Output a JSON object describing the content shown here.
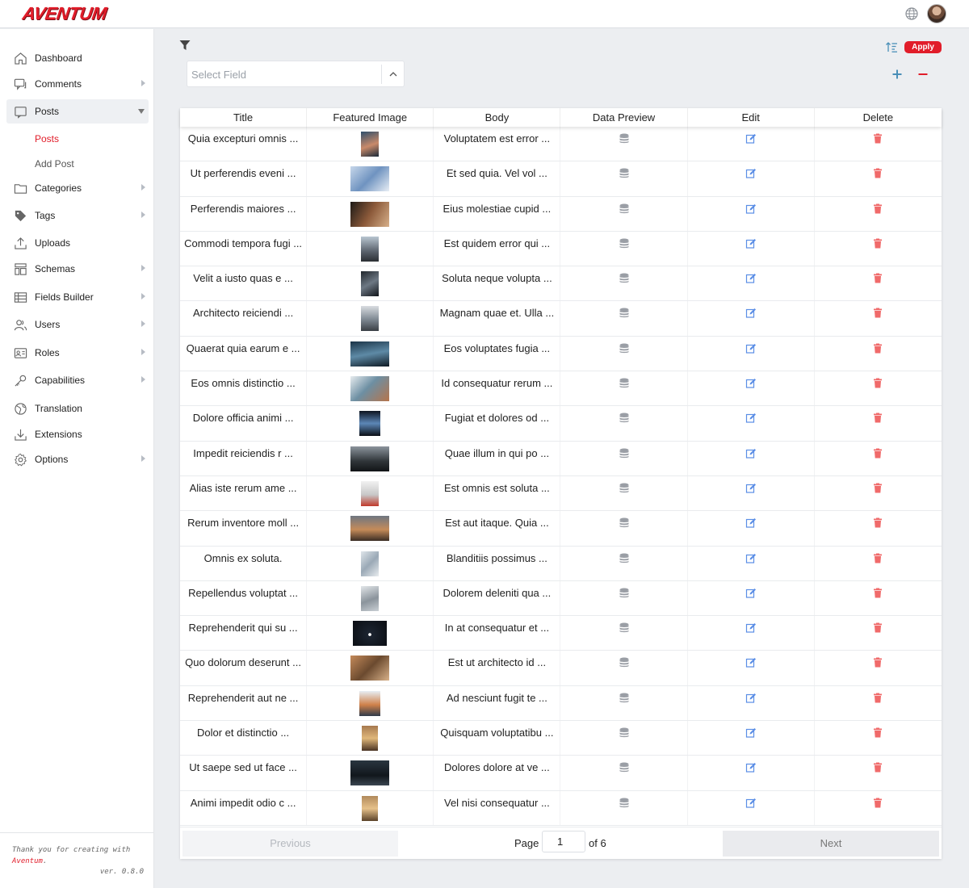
{
  "header": {
    "logo": "AVENTUM",
    "globe_icon": "globe-icon",
    "avatar_icon": "user-avatar"
  },
  "sidebar": {
    "items": [
      {
        "label": "Dashboard",
        "icon": "home-icon"
      },
      {
        "label": "Comments",
        "icon": "comments-icon"
      },
      {
        "label": "Posts",
        "icon": "posts-icon"
      },
      {
        "label": "Categories",
        "icon": "folder-icon"
      },
      {
        "label": "Tags",
        "icon": "tag-icon"
      },
      {
        "label": "Uploads",
        "icon": "upload-icon"
      },
      {
        "label": "Schemas",
        "icon": "schema-icon"
      },
      {
        "label": "Fields Builder",
        "icon": "fields-icon"
      },
      {
        "label": "Users",
        "icon": "users-icon"
      },
      {
        "label": "Roles",
        "icon": "roles-icon"
      },
      {
        "label": "Capabilities",
        "icon": "key-icon"
      },
      {
        "label": "Translation",
        "icon": "globe-icon"
      },
      {
        "label": "Extensions",
        "icon": "download-icon"
      },
      {
        "label": "Options",
        "icon": "gear-icon"
      }
    ],
    "sub_items": [
      {
        "label": "Posts"
      },
      {
        "label": "Add Post"
      }
    ],
    "footer": {
      "line1": "Thank you for creating with",
      "brand": "Aventum",
      "brand_suffix": ".",
      "version": "ver. 0.8.0"
    }
  },
  "filter": {
    "select_placeholder": "Select Field",
    "apply_label": "Apply"
  },
  "colors": {
    "accent": "#e11d2a",
    "edit_icon": "#5b8ee6",
    "delete_icon": "#f06a6a",
    "db_icon": "#9a9ea5",
    "plus": "#4a8fb8"
  },
  "table": {
    "columns": [
      "Title",
      "Featured Image",
      "Body",
      "Data Preview",
      "Edit",
      "Delete"
    ],
    "rows": [
      {
        "title": "Quia excepturi omnis ...",
        "body": "Voluptatem est error ..."
      },
      {
        "title": "Ut perferendis eveni ...",
        "body": "Et sed quia. Vel vol ..."
      },
      {
        "title": "Perferendis maiores ...",
        "body": "Eius molestiae cupid ..."
      },
      {
        "title": "Commodi tempora fugi ...",
        "body": "Est quidem error qui ..."
      },
      {
        "title": "Velit a iusto quas e ...",
        "body": "Soluta neque volupta ..."
      },
      {
        "title": "Architecto reiciendi ...",
        "body": "Magnam quae et. Ulla ..."
      },
      {
        "title": "Quaerat quia earum e ...",
        "body": "Eos voluptates fugia ..."
      },
      {
        "title": "Eos omnis distinctio ...",
        "body": "Id consequatur rerum ..."
      },
      {
        "title": "Dolore officia animi ...",
        "body": "Fugiat et dolores od ..."
      },
      {
        "title": "Impedit reiciendis r ...",
        "body": "Quae illum in qui po ..."
      },
      {
        "title": "Alias iste rerum ame ...",
        "body": "Est omnis est soluta ..."
      },
      {
        "title": "Rerum inventore moll ...",
        "body": "Est aut itaque. Quia ..."
      },
      {
        "title": "Omnis ex soluta.",
        "body": "Blanditiis possimus ..."
      },
      {
        "title": "Repellendus voluptat ...",
        "body": "Dolorem deleniti qua ..."
      },
      {
        "title": "Reprehenderit qui su ...",
        "body": "In at consequatur et ..."
      },
      {
        "title": "Quo dolorum deserunt ...",
        "body": "Est ut architecto id ..."
      },
      {
        "title": "Reprehenderit aut ne ...",
        "body": "Ad nesciunt fugit te ..."
      },
      {
        "title": "Dolor et distinctio ...",
        "body": "Quisquam voluptatibu ..."
      },
      {
        "title": "Ut saepe sed ut face ...",
        "body": "Dolores dolore at ve ..."
      },
      {
        "title": "Animi impedit odio c ...",
        "body": "Vel nisi consequatur ..."
      }
    ]
  },
  "pagination": {
    "previous_label": "Previous",
    "page_label": "Page",
    "current_page": "1",
    "of_label": "of 6",
    "next_label": "Next"
  }
}
